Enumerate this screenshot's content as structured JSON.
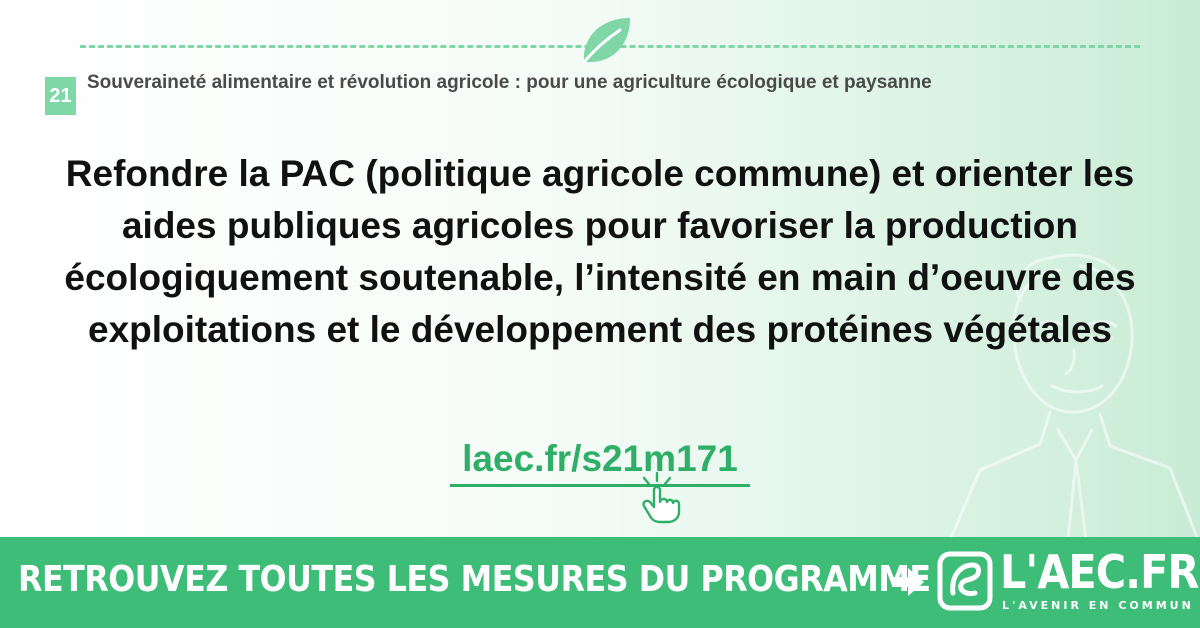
{
  "theme": {
    "number": "21",
    "title": "Souveraineté alimentaire et révolution agricole : pour une agriculture écologique et paysanne"
  },
  "measure": {
    "headline": "Refondre la PAC (politique agricole commune) et orienter les aides publiques agricoles pour favoriser la production écologiquement soutenable, l’intensité en main d’oeuvre des exploitations et le développement des protéines végétales",
    "link_text": "laec.fr/s21m171"
  },
  "footer": {
    "cta": "RETROUVEZ TOUTES LES MESURES DU PROGRAMME",
    "logo_text": "L'AEC.FR",
    "logo_tagline": "L'AVENIR EN COMMUN"
  },
  "colors": {
    "accent": "#3dbd78",
    "light_accent": "#7fd6a6",
    "link": "#2fae68",
    "text": "#111111"
  },
  "icons": [
    "leaf-icon",
    "pointing-hand-icon",
    "arrow-right-icon",
    "laec-logo-icon"
  ]
}
